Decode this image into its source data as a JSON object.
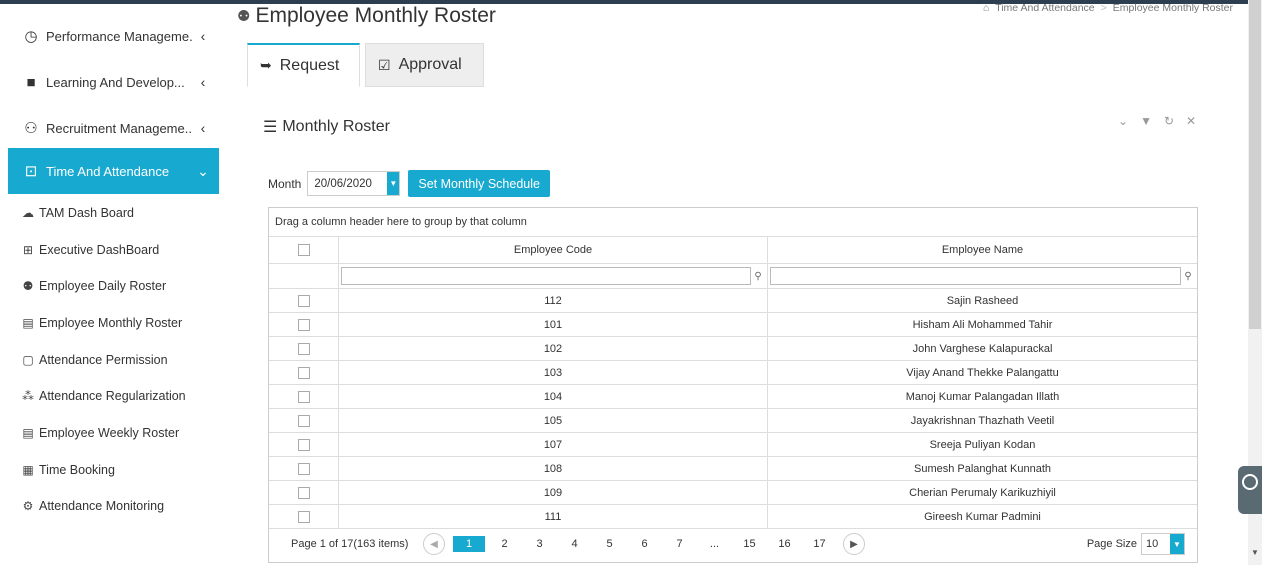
{
  "sidebar": {
    "items": [
      {
        "label": "Performance Manageme...",
        "icon": "gauge-icon"
      },
      {
        "label": "Learning And Develop...",
        "icon": "book-icon"
      },
      {
        "label": "Recruitment Manageme...",
        "icon": "recruit-icon"
      },
      {
        "label": "Time And Attendance",
        "icon": "clock-icon"
      }
    ],
    "sub_items": [
      {
        "label": "TAM Dash Board",
        "icon": "cloud-icon"
      },
      {
        "label": "Executive DashBoard",
        "icon": "grid-icon"
      },
      {
        "label": "Employee Daily Roster",
        "icon": "people-icon"
      },
      {
        "label": "Employee Monthly Roster",
        "icon": "calendar-icon"
      },
      {
        "label": "Attendance Permission",
        "icon": "document-icon"
      },
      {
        "label": "Attendance Regularization",
        "icon": "network-icon"
      },
      {
        "label": "Employee Weekly Roster",
        "icon": "calendar-icon"
      },
      {
        "label": "Time Booking",
        "icon": "table-icon"
      },
      {
        "label": "Attendance Monitoring",
        "icon": "monitor-icon"
      }
    ]
  },
  "page": {
    "title": "Employee Monthly Roster"
  },
  "breadcrumb": {
    "home": "Time And Attendance",
    "separator": ">",
    "current": "Employee Monthly Roster"
  },
  "tabs": [
    {
      "label": "Request",
      "active": true
    },
    {
      "label": "Approval",
      "active": false
    }
  ],
  "panel": {
    "title": "Monthly Roster"
  },
  "filter": {
    "month_label": "Month",
    "month_value": "20/06/2020",
    "set_button": "Set Monthly Schedule"
  },
  "grid": {
    "group_hint": "Drag a column header here to group by that column",
    "columns": [
      "Employee Code",
      "Employee Name"
    ],
    "rows": [
      {
        "code": "112",
        "name": "Sajin Rasheed"
      },
      {
        "code": "101",
        "name": "Hisham Ali Mohammed Tahir"
      },
      {
        "code": "102",
        "name": "John Varghese Kalapurackal"
      },
      {
        "code": "103",
        "name": "Vijay Anand Thekke Palangattu"
      },
      {
        "code": "104",
        "name": "Manoj Kumar Palangadan Illath"
      },
      {
        "code": "105",
        "name": "Jayakrishnan Thazhath Veetil"
      },
      {
        "code": "107",
        "name": "Sreeja Puliyan Kodan"
      },
      {
        "code": "108",
        "name": "Sumesh Palanghat Kunnath"
      },
      {
        "code": "109",
        "name": "Cherian Perumaly Karikuzhiyil"
      },
      {
        "code": "111",
        "name": "Gireesh Kumar Padmini"
      }
    ]
  },
  "pager": {
    "info": "Page 1 of 17(163 items)",
    "pages": [
      "1",
      "2",
      "3",
      "4",
      "5",
      "6",
      "7",
      "...",
      "15",
      "16",
      "17"
    ],
    "current_page": "1",
    "page_size_label": "Page Size",
    "page_size": "10"
  },
  "colors": {
    "accent": "#17a9cf"
  }
}
